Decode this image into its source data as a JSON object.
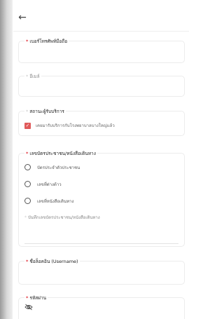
{
  "fields": {
    "phone": {
      "required_mark": "*",
      "label": "เบอร์โทรศัพท์มือถือ"
    },
    "email": {
      "required_mark": "*",
      "label": "อีเมล์"
    },
    "status": {
      "required_mark": "*",
      "label": "สถานะผู้รับบริการ",
      "checkbox_label": "เคยมารับบริการกับโรงพยาบาลบางใหญ่แล้ว",
      "checked": true
    },
    "id_document": {
      "required_mark": "*",
      "label": "เลขบัตรประชาชน/หนังสือเดินทาง",
      "options": [
        "บัตรประจำตัวประชาชน",
        "เลขที่ต่างด้าว",
        "เลขที่หนังสือเดินทาง"
      ],
      "input_label": "บันทึกเลขบัตรประชาชน/หนังสือเดินทาง",
      "input_mark": "*"
    },
    "username": {
      "required_mark": "*",
      "label": "ชื่อล็อคอิน (Username)"
    },
    "password": {
      "required_mark": "*",
      "label": "รหัสผ่าน"
    }
  },
  "icons": {
    "back": "arrow-left-icon",
    "visibility": "eye-slash-icon",
    "check": "check-icon"
  },
  "colors": {
    "required": "#e0303a",
    "checkbox": "#e05a5a",
    "border": "#ececec"
  }
}
